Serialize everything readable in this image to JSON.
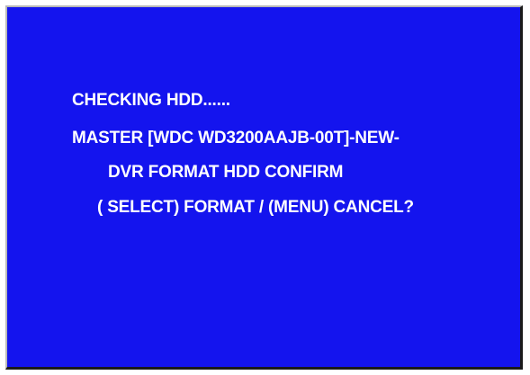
{
  "screen": {
    "background_color": "#1414ee",
    "text_color": "#ffffff",
    "lines": [
      "CHECKING HDD......",
      "MASTER  [WDC WD3200AAJB-00T]-NEW-",
      "DVR FORMAT HDD CONFIRM",
      "( SELECT) FORMAT  / (MENU) CANCEL?"
    ]
  }
}
